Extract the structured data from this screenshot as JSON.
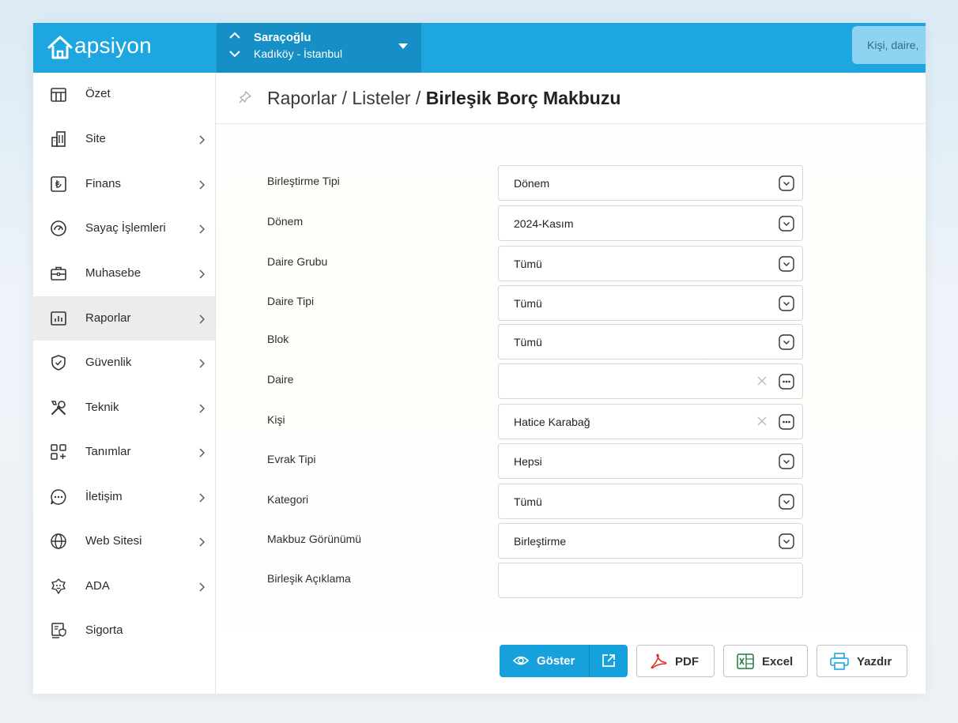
{
  "app": {
    "logo_text": "apsiyon"
  },
  "site": {
    "name": "Saraçoğlu",
    "location": "Kadıköy - İstanbul"
  },
  "search": {
    "placeholder": "Kişi, daire,"
  },
  "sidebar": {
    "items": [
      {
        "label": "Özet",
        "icon": "table-icon",
        "has_children": false,
        "active": false
      },
      {
        "label": "Site",
        "icon": "building-icon",
        "has_children": true,
        "active": false
      },
      {
        "label": "Finans",
        "icon": "lira-icon",
        "has_children": true,
        "active": false
      },
      {
        "label": "Sayaç İşlemleri",
        "icon": "gauge-icon",
        "has_children": true,
        "active": false
      },
      {
        "label": "Muhasebe",
        "icon": "briefcase-icon",
        "has_children": true,
        "active": false
      },
      {
        "label": "Raporlar",
        "icon": "report-chart-icon",
        "has_children": true,
        "active": true
      },
      {
        "label": "Güvenlik",
        "icon": "shield-icon",
        "has_children": true,
        "active": false
      },
      {
        "label": "Teknik",
        "icon": "tools-icon",
        "has_children": true,
        "active": false
      },
      {
        "label": "Tanımlar",
        "icon": "grid-plus-icon",
        "has_children": true,
        "active": false
      },
      {
        "label": "İletişim",
        "icon": "chat-icon",
        "has_children": true,
        "active": false
      },
      {
        "label": "Web Sitesi",
        "icon": "globe-icon",
        "has_children": true,
        "active": false
      },
      {
        "label": "ADA",
        "icon": "ada-assistant-icon",
        "has_children": true,
        "active": false
      },
      {
        "label": "Sigorta",
        "icon": "insurance-icon",
        "has_children": false,
        "active": false
      }
    ]
  },
  "breadcrumb": {
    "part1": "Raporlar",
    "part2": "Listeler",
    "current": "Birleşik Borç Makbuzu",
    "separator": " / "
  },
  "form": {
    "fields": [
      {
        "label": "Birleştirme Tipi",
        "value": "Dönem",
        "kind": "select"
      },
      {
        "label": "Dönem",
        "value": "2024-Kasım",
        "kind": "select"
      },
      {
        "label": "Daire Grubu",
        "value": "Tümü",
        "kind": "select"
      },
      {
        "label": "Daire Tipi",
        "value": "Tümü",
        "kind": "select"
      },
      {
        "label": "Blok",
        "value": "Tümü",
        "kind": "select"
      },
      {
        "label": "Daire",
        "value": "",
        "kind": "lookup"
      },
      {
        "label": "Kişi",
        "value": "Hatice Karabağ",
        "kind": "lookup"
      },
      {
        "label": "Evrak Tipi",
        "value": "Hepsi",
        "kind": "select"
      },
      {
        "label": "Kategori",
        "value": "Tümü",
        "kind": "select"
      },
      {
        "label": "Makbuz Görünümü",
        "value": "Birleştirme",
        "kind": "select"
      },
      {
        "label": "Birleşik Açıklama",
        "value": "",
        "kind": "text"
      }
    ]
  },
  "actions": {
    "show": "Göster",
    "pdf": "PDF",
    "excel": "Excel",
    "print": "Yazdır"
  },
  "colors": {
    "brand": "#1ea6e0",
    "brand_dark": "#168fc6",
    "primary_button": "#16a0dc",
    "pdf_red": "#e2231a",
    "excel_green": "#1d7a3e"
  }
}
